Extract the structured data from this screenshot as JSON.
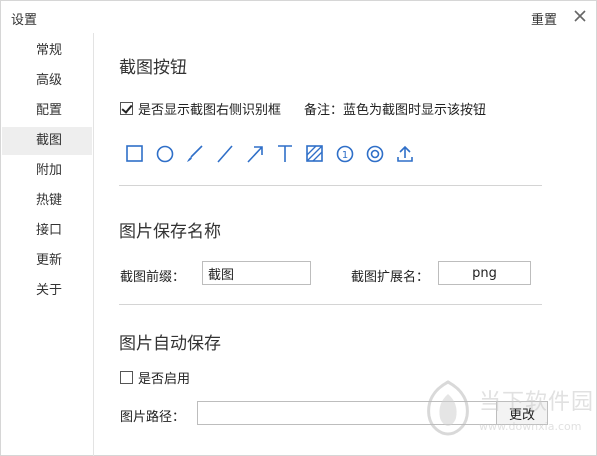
{
  "window": {
    "title": "设置",
    "reset_label": "重置"
  },
  "sidebar": {
    "items": [
      {
        "label": "常规"
      },
      {
        "label": "高级"
      },
      {
        "label": "配置"
      },
      {
        "label": "截图",
        "active": true
      },
      {
        "label": "附加"
      },
      {
        "label": "热键"
      },
      {
        "label": "接口"
      },
      {
        "label": "更新"
      },
      {
        "label": "关于"
      }
    ]
  },
  "screenshot_buttons": {
    "title": "截图按钮",
    "show_recognition_label": "是否显示截图右侧识别框",
    "show_recognition_checked": true,
    "note": "备注：蓝色为截图时显示该按钮",
    "tools": [
      "rectangle-icon",
      "ellipse-icon",
      "brush-icon",
      "line-icon",
      "arrow-icon",
      "text-icon",
      "mosaic-icon",
      "number-icon",
      "target-icon",
      "upload-icon"
    ],
    "tool_number_glyph": "1",
    "tool_text_glyph": "T",
    "accent_color": "#2f6fc8"
  },
  "save_name": {
    "title": "图片保存名称",
    "prefix_label": "截图前缀：",
    "prefix_value": "截图",
    "ext_label": "截图扩展名：",
    "ext_value": "png"
  },
  "auto_save": {
    "title": "图片自动保存",
    "enable_label": "是否启用",
    "enable_checked": false,
    "path_label": "图片路径：",
    "path_value": "",
    "change_label": "更改"
  },
  "watermark": {
    "brand": "当下软件园",
    "url": "www.downxia.com"
  }
}
